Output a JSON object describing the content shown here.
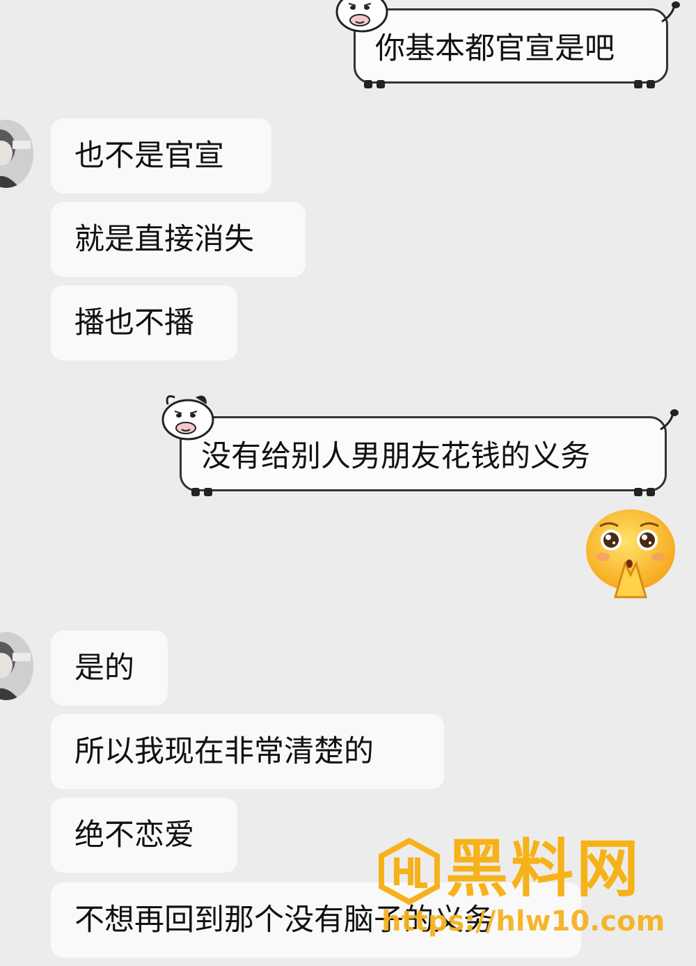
{
  "messages": [
    {
      "side": "right",
      "text": "你基本都官宣是吧"
    },
    {
      "side": "left",
      "text": "也不是官宣"
    },
    {
      "side": "left",
      "text": "就是直接消失"
    },
    {
      "side": "left",
      "text": "播也不播"
    },
    {
      "side": "right",
      "text": "没有给别人男朋友花钱的义务"
    },
    {
      "side": "right",
      "sticker": "pleading-face-emoji"
    },
    {
      "side": "left",
      "text": "是的"
    },
    {
      "side": "left",
      "text": "所以我现在非常清楚的"
    },
    {
      "side": "left",
      "text": "绝不恋爱"
    },
    {
      "side": "left",
      "text": "不想再回到那个没有脑子的义务"
    }
  ],
  "watermark": {
    "title": "黑料网",
    "url": "https://hlw10.com"
  },
  "colors": {
    "background": "#ececec",
    "bubble": "#f9f9f9",
    "watermark": "#f6b21a"
  }
}
